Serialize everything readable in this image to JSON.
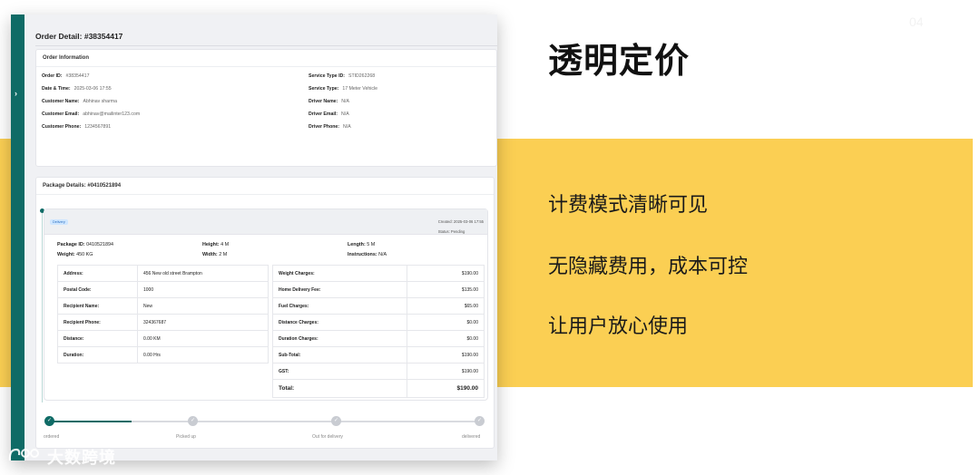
{
  "slide": {
    "page_number": "04",
    "headline": "透明定价",
    "bullets": [
      "计费模式清晰可见",
      "无隐藏费用，成本可控",
      "让用户放心使用"
    ],
    "watermark": "大数跨境",
    "accent_color": "#fbcf53"
  },
  "app": {
    "page_title": "Order Detail: #38354417",
    "sidebar_toggle": "›",
    "order_info": {
      "header": "Order Information",
      "left": [
        {
          "label": "Order ID:",
          "value": "#38354417"
        },
        {
          "label": "Date & Time:",
          "value": "2025-03-06 17:55"
        },
        {
          "label": "Customer Name:",
          "value": "Abhinav sharma"
        },
        {
          "label": "Customer Email:",
          "value": "abhinav@mailinter123.com"
        },
        {
          "label": "Customer Phone:",
          "value": "1234567891"
        }
      ],
      "right": [
        {
          "label": "Service Type ID:",
          "value": "STID262268"
        },
        {
          "label": "Service Type:",
          "value": "17 Meter Vehicle"
        },
        {
          "label": "Driver Name:",
          "value": "N/A"
        },
        {
          "label": "Driver Email:",
          "value": "N/A"
        },
        {
          "label": "Driver Phone:",
          "value": "N/A"
        }
      ]
    },
    "package": {
      "header": "Package Details: #0410521894",
      "badge": "Delivery",
      "created": "Created: 2025-03-06 17:55",
      "status": "Status: Pending",
      "package_id_label": "Package ID:",
      "package_id": "0410521894",
      "weight_label": "Weight:",
      "weight": "450 KG",
      "height_label": "Height:",
      "height": "4 M",
      "width_label": "Width:",
      "width": "2 M",
      "length_label": "Length:",
      "length": "5 M",
      "instructions_label": "Instructions:",
      "instructions": "N/A",
      "address_rows": [
        {
          "label": "Address:",
          "value": "456 New old street Brampton"
        },
        {
          "label": "Postal Code:",
          "value": "1000"
        },
        {
          "label": "Recipient Name:",
          "value": "New"
        },
        {
          "label": "Recipient Phone:",
          "value": "324367687"
        },
        {
          "label": "Distance:",
          "value": "0.00 KM"
        },
        {
          "label": "Duration:",
          "value": "0.00 Hrs"
        }
      ],
      "charge_rows": [
        {
          "label": "Weight Charges:",
          "value": "$190.00"
        },
        {
          "label": "Home Delivery Fee:",
          "value": "$135.00"
        },
        {
          "label": "Fuel Charges:",
          "value": "$65.00"
        },
        {
          "label": "Distance Charges:",
          "value": "$0.00"
        },
        {
          "label": "Duration Charges:",
          "value": "$0.00"
        },
        {
          "label": "Sub-Total:",
          "value": "$190.00"
        },
        {
          "label": "GST:",
          "value": "$190.00"
        }
      ],
      "total_label": "Total:",
      "total_value": "$190.00"
    },
    "progress": {
      "steps": [
        "ordered",
        "Picked up",
        "Out for delivery",
        "delivered"
      ],
      "check": "✓",
      "completed_steps": 1
    }
  }
}
